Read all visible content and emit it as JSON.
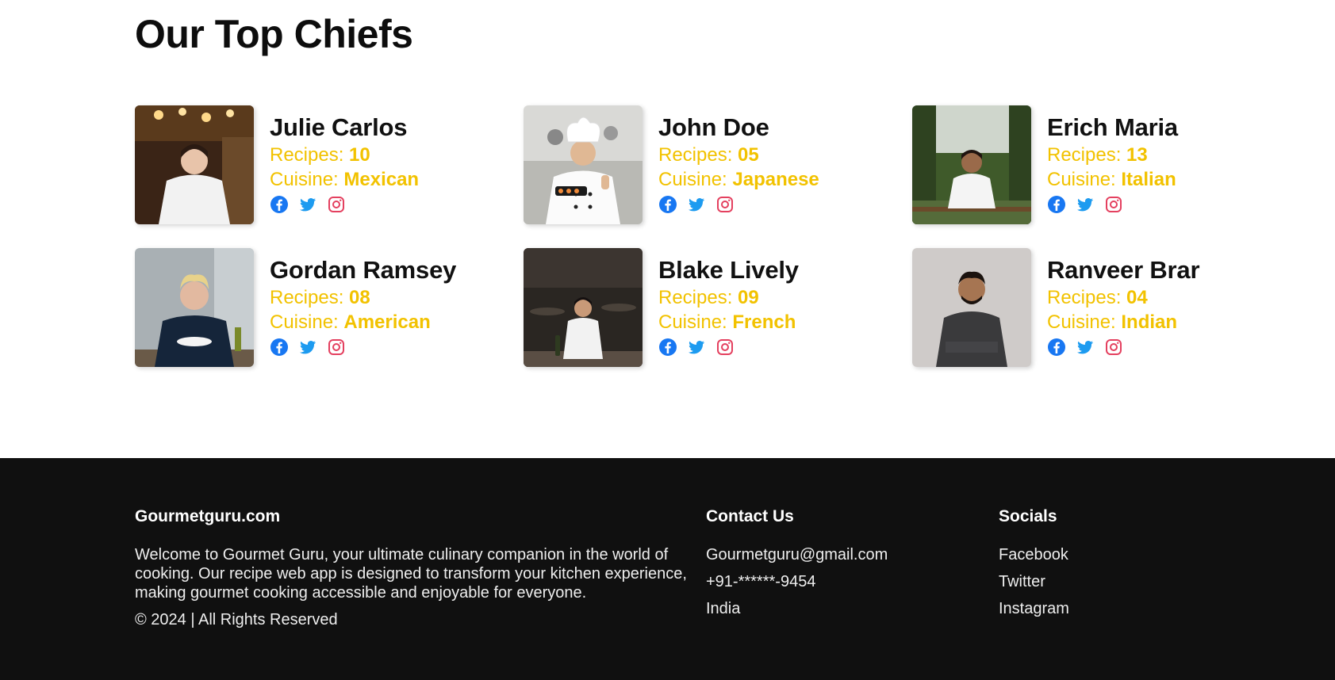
{
  "page": {
    "section_title": "Our Top Chiefs"
  },
  "labels": {
    "recipes": "Recipes: ",
    "cuisine": "Cuisine: "
  },
  "chefs": [
    {
      "name": "Julie Carlos",
      "recipes": "10",
      "cuisine": "Mexican"
    },
    {
      "name": "John Doe",
      "recipes": "05",
      "cuisine": "Japanese"
    },
    {
      "name": "Erich Maria",
      "recipes": "13",
      "cuisine": "Italian"
    },
    {
      "name": "Gordan Ramsey",
      "recipes": "08",
      "cuisine": "American"
    },
    {
      "name": "Blake Lively",
      "recipes": "09",
      "cuisine": "French"
    },
    {
      "name": "Ranveer Brar",
      "recipes": "04",
      "cuisine": "Indian"
    }
  ],
  "social_icons": [
    "facebook-icon",
    "twitter-icon",
    "instagram-icon"
  ],
  "footer": {
    "brand": "Gourmetguru.com",
    "about": "Welcome to Gourmet Guru, your ultimate culinary companion in the world of cooking. Our recipe web app is designed to transform your kitchen experience, making gourmet cooking accessible and enjoyable for everyone.",
    "copyright": "© 2024 | All Rights Reserved",
    "contact_title": "Contact Us",
    "email": "Gourmetguru@gmail.com",
    "phone": "+91-******-9454",
    "country": "India",
    "socials_title": "Socials",
    "social_links": [
      "Facebook",
      "Twitter",
      "Instagram"
    ]
  },
  "colors": {
    "accent": "#f2c200",
    "footer_bg": "#101010",
    "facebook": "#1877f2",
    "twitter": "#1d9bf0",
    "instagram": "#e4405f"
  }
}
